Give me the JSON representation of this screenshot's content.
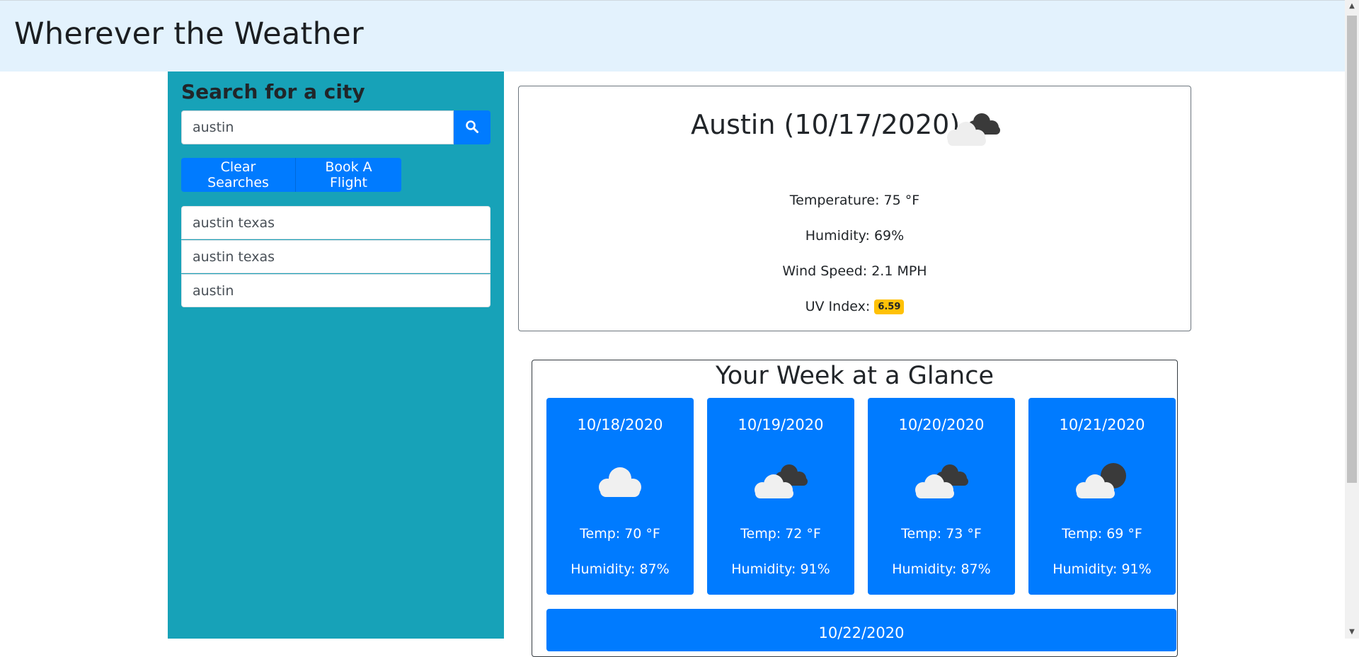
{
  "app": {
    "title": "Wherever the Weather"
  },
  "sidebar": {
    "heading": "Search for a city",
    "search": {
      "value": "austin",
      "button_icon": "search-icon"
    },
    "buttons": {
      "clear": "Clear Searches",
      "flight": "Book A Flight"
    },
    "history": [
      "austin texas",
      "austin texas",
      "austin"
    ]
  },
  "current": {
    "title": "Austin (10/17/2020)",
    "icon": "broken-clouds-icon",
    "temperature": "Temperature: 75 °F",
    "humidity": "Humidity: 69%",
    "wind": "Wind Speed: 2.1 MPH",
    "uv_label": "UV Index:",
    "uv_value": "6.59",
    "uv_color": "#ffc107"
  },
  "forecast": {
    "heading": "Your Week at a Glance",
    "days": [
      {
        "date": "10/18/2020",
        "icon": "cloud-icon",
        "temp": "Temp: 70 °F",
        "humidity": "Humidity: 87%"
      },
      {
        "date": "10/19/2020",
        "icon": "broken-clouds-icon",
        "temp": "Temp: 72 °F",
        "humidity": "Humidity: 91%"
      },
      {
        "date": "10/20/2020",
        "icon": "broken-clouds-icon",
        "temp": "Temp: 73 °F",
        "humidity": "Humidity: 87%"
      },
      {
        "date": "10/21/2020",
        "icon": "cloud-night-icon",
        "temp": "Temp: 69 °F",
        "humidity": "Humidity: 91%"
      },
      {
        "date": "10/22/2020"
      }
    ]
  },
  "colors": {
    "navbar": "#e3f2fd",
    "sidebar": "#17a2b8",
    "primary": "#007bff"
  }
}
